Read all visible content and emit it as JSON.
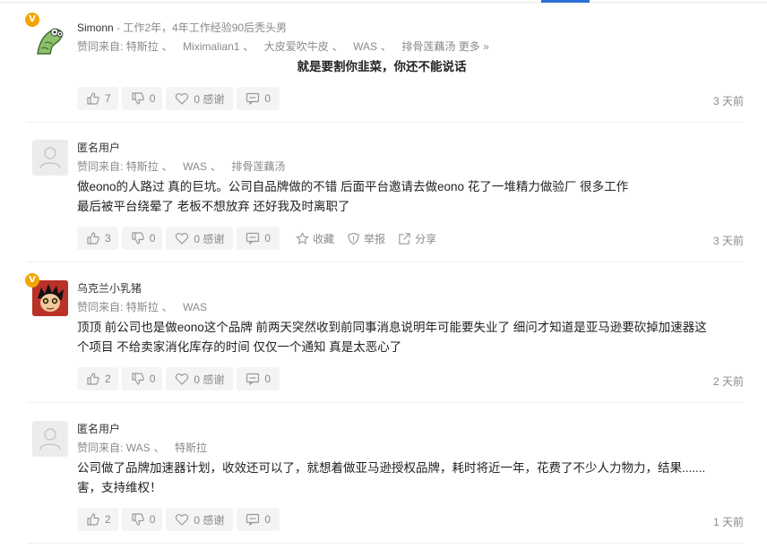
{
  "comments": [
    {
      "username": "Simonn",
      "meta": " - 工作2年，4年工作经验90后秃头男",
      "agree_prefix": "赞同来自:",
      "agreers": [
        "特斯拉",
        "Miximalian1",
        "大皮爱吹牛皮",
        "WAS",
        "排骨莲藕汤"
      ],
      "more": "更多 »",
      "text_lines": [
        "就是要割你韭菜，你还不能说话"
      ],
      "likes": "7",
      "dislikes": "0",
      "thanks": "0 感谢",
      "replies": "0",
      "time": "3 天前"
    },
    {
      "username": "匿名用户",
      "agree_prefix": "赞同来自:",
      "agreers": [
        "特斯拉",
        "WAS",
        "排骨莲藕汤"
      ],
      "text_lines": [
        "做eono的人路过 真的巨坑。公司自品牌做的不错 后面平台邀请去做eono 花了一堆精力做验厂 很多工作",
        "最后被平台绕晕了 老板不想放弃 还好我及时离职了"
      ],
      "likes": "3",
      "dislikes": "0",
      "thanks": "0 感谢",
      "replies": "0",
      "collect": "收藏",
      "report": "举报",
      "share": "分享",
      "time": "3 天前"
    },
    {
      "username": "乌克兰小乳猪",
      "agree_prefix": "赞同来自:",
      "agreers": [
        "特斯拉",
        "WAS"
      ],
      "text_lines": [
        "顶顶 前公司也是做eono这个品牌 前两天突然收到前同事消息说明年可能要失业了 细问才知道是亚马逊要砍掉加速器这",
        "个项目 不给卖家消化库存的时间 仅仅一个通知 真是太恶心了"
      ],
      "likes": "2",
      "dislikes": "0",
      "thanks": "0 感谢",
      "replies": "0",
      "time": "2 天前"
    },
    {
      "username": "匿名用户",
      "agree_prefix": "赞同来自:",
      "agreers": [
        "WAS",
        "特斯拉"
      ],
      "text_lines": [
        "公司做了品牌加速器计划，收效还可以了，就想着做亚马逊授权品牌，耗时将近一年，花费了不少人力物力，结果.......",
        "害，支持维权！"
      ],
      "likes": "2",
      "dislikes": "0",
      "thanks": "0 感谢",
      "replies": "0",
      "time": "1 天前"
    }
  ],
  "badge_letter": "V",
  "colors": {
    "accent": "#2c6fd6",
    "badge": "#f0a500",
    "muted": "#8a8a8a"
  }
}
